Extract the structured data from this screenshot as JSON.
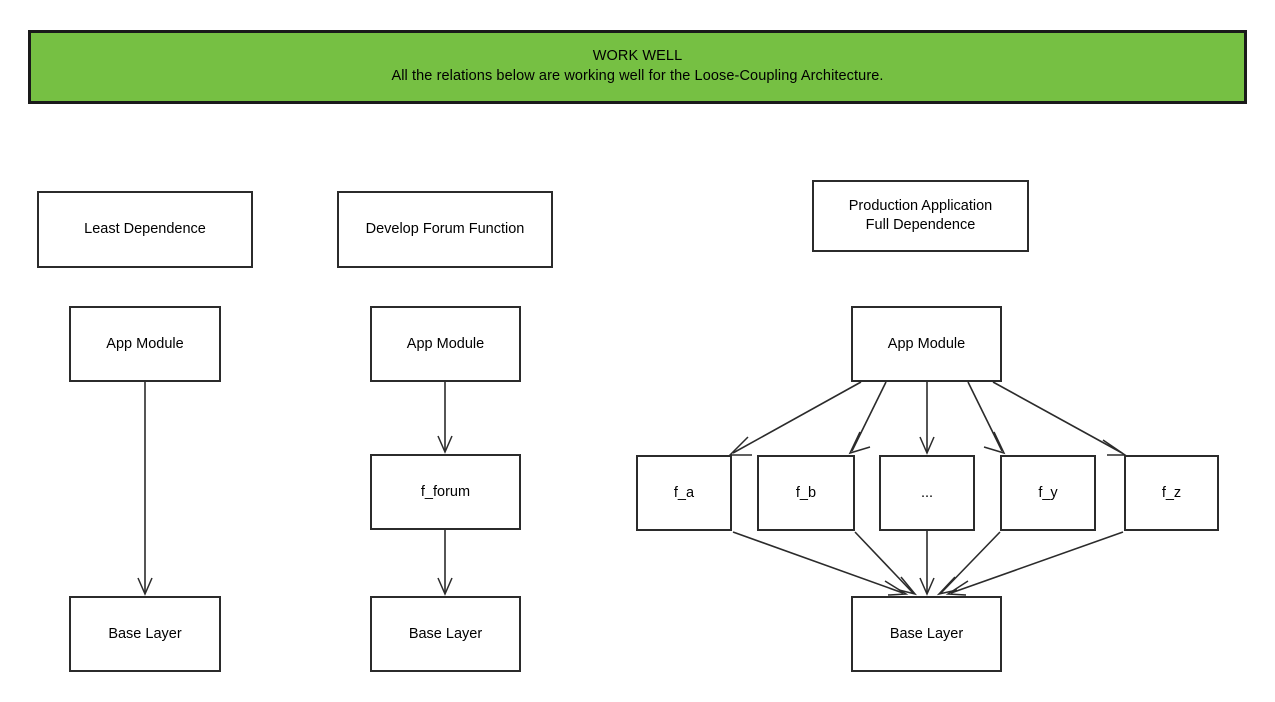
{
  "banner": {
    "title": "WORK WELL",
    "subtitle": "All the relations below are working well for the Loose-Coupling Architecture.",
    "background_color": "#76c043",
    "border_color": "#1a1a1a",
    "text_color": "#000000"
  },
  "diagram": {
    "stroke_color": "#2b2b2b",
    "node_fill": "#ffffff",
    "columns": [
      {
        "id": "least-dependence",
        "heading": "Least Dependence",
        "nodes": [
          {
            "id": "app-1",
            "label": "App Module"
          },
          {
            "id": "base-1",
            "label": "Base Layer"
          }
        ],
        "edges": [
          {
            "from": "app-1",
            "to": "base-1"
          }
        ]
      },
      {
        "id": "develop-forum",
        "heading": "Develop Forum Function",
        "nodes": [
          {
            "id": "app-2",
            "label": "App Module"
          },
          {
            "id": "f-forum",
            "label": "f_forum"
          },
          {
            "id": "base-2",
            "label": "Base Layer"
          }
        ],
        "edges": [
          {
            "from": "app-2",
            "to": "f-forum"
          },
          {
            "from": "f-forum",
            "to": "base-2"
          }
        ]
      },
      {
        "id": "production-application",
        "heading_line_1": "Production Application",
        "heading_line_2": "Full Dependence",
        "nodes": [
          {
            "id": "app-3",
            "label": "App Module"
          },
          {
            "id": "f-a",
            "label": "f_a"
          },
          {
            "id": "f-b",
            "label": "f_b"
          },
          {
            "id": "f-ellipsis",
            "label": "..."
          },
          {
            "id": "f-y",
            "label": "f_y"
          },
          {
            "id": "f-z",
            "label": "f_z"
          },
          {
            "id": "base-3",
            "label": "Base Layer"
          }
        ],
        "edges": [
          {
            "from": "app-3",
            "to": "f-a"
          },
          {
            "from": "app-3",
            "to": "f-b"
          },
          {
            "from": "app-3",
            "to": "f-ellipsis"
          },
          {
            "from": "app-3",
            "to": "f-y"
          },
          {
            "from": "app-3",
            "to": "f-z"
          },
          {
            "from": "f-a",
            "to": "base-3"
          },
          {
            "from": "f-b",
            "to": "base-3"
          },
          {
            "from": "f-ellipsis",
            "to": "base-3"
          },
          {
            "from": "f-y",
            "to": "base-3"
          },
          {
            "from": "f-z",
            "to": "base-3"
          }
        ]
      }
    ]
  }
}
